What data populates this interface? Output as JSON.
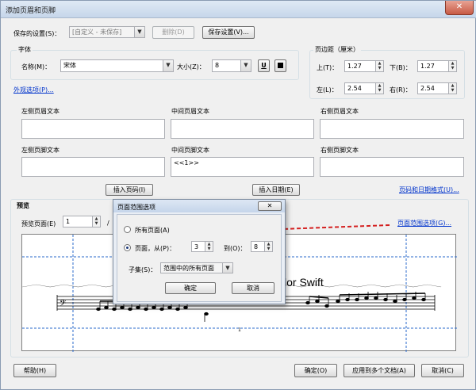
{
  "window": {
    "title": "添加页眉和页脚",
    "close": "✕"
  },
  "saved_settings": {
    "label": "保存的设置(S)：",
    "value": "[自定义 - 未保存]",
    "delete_label": "删除(D)",
    "save_label": "保存设置(V)..."
  },
  "font": {
    "section_label": "字体",
    "name_label": "名称(M)：",
    "name_value": "宋体",
    "size_label": "大小(Z)：",
    "size_value": "8",
    "underline_glyph": "U",
    "appearance_link": "外观选项(P)..."
  },
  "margins": {
    "section_label": "页边距（厘米）",
    "top_label": "上(T)：",
    "top_value": "1.27",
    "bottom_label": "下(B)：",
    "bottom_value": "1.27",
    "left_label": "左(L)：",
    "left_value": "2.54",
    "right_label": "右(R)：",
    "right_value": "2.54"
  },
  "header": {
    "left_label": "左侧页眉文本",
    "center_label": "中间页眉文本",
    "right_label": "右侧页眉文本"
  },
  "footer": {
    "left_label": "左侧页脚文本",
    "center_label": "中间页脚文本",
    "center_value": "<<1>>",
    "right_label": "右侧页脚文本"
  },
  "insert": {
    "page_number": "插入页码(I)",
    "date": "插入日期(E)",
    "format_link": "页码和日期格式(U)..."
  },
  "preview": {
    "section_label": "预览",
    "page_label": "预览页面(E)",
    "page_value": "1",
    "of_sep": "/",
    "range_link": "页面范围选项(G)...",
    "title_text": "lor Swift",
    "page_num": "1"
  },
  "range_dialog": {
    "title": "页面范围选项",
    "close": "✕",
    "all_pages": "所有页面(A)",
    "pages_from": "页面，从(P)：",
    "from_value": "3",
    "to_label": "到(O)：",
    "to_value": "8",
    "subset_label": "子集(S)：",
    "subset_value": "范围中的所有页面",
    "ok": "确定",
    "cancel": "取消"
  },
  "footer_buttons": {
    "help": "帮助(H)",
    "ok": "确定(O)",
    "apply_multiple": "应用到多个文档(A)",
    "cancel": "取消(C)"
  },
  "colors": {
    "arrow": "#d42020",
    "link": "#0033cc",
    "guide": "#2a6acb"
  }
}
